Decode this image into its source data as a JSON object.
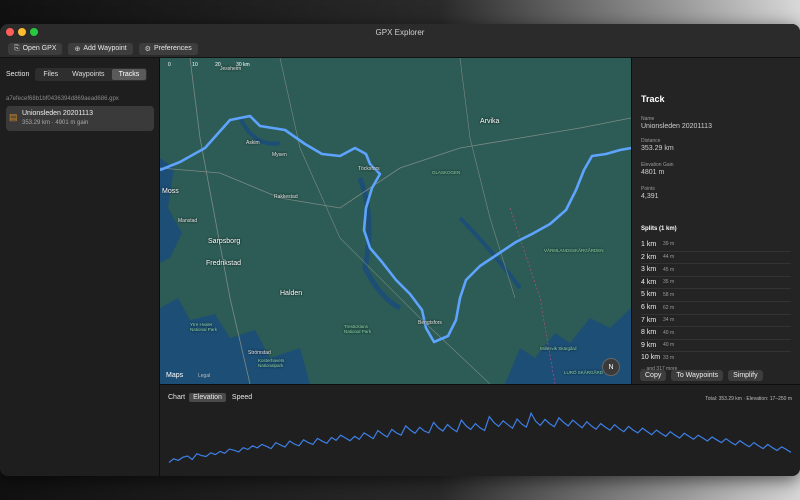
{
  "window": {
    "title": "GPX Explorer"
  },
  "toolbar": {
    "open_label": "Open GPX",
    "add_waypoint_label": "Add Waypoint",
    "preferences_label": "Preferences"
  },
  "sidebar": {
    "section_label": "Section",
    "tabs": [
      "Files",
      "Waypoints",
      "Tracks"
    ],
    "active_tab": "Tracks",
    "file_name": "a7efecef68b1bf0436394d869aead686.gpx",
    "track": {
      "name": "Unionsleden 20201113",
      "subtitle": "353.29 km · 4901 m gain"
    }
  },
  "map": {
    "scale_ticks": [
      "0",
      "10",
      "20",
      "30 km"
    ],
    "labels": [
      {
        "text": "Arvika",
        "cls": "big"
      },
      {
        "text": "Askim",
        "cls": ""
      },
      {
        "text": "Mysen",
        "cls": ""
      },
      {
        "text": "Töcksfors",
        "cls": ""
      },
      {
        "text": "Rakkestad",
        "cls": ""
      },
      {
        "text": "Moss",
        "cls": "big"
      },
      {
        "text": "Sarpsborg",
        "cls": "big"
      },
      {
        "text": "Fredrikstad",
        "cls": "big"
      },
      {
        "text": "Halden",
        "cls": "big"
      },
      {
        "text": "Strömstad",
        "cls": ""
      },
      {
        "text": "Bengtsfors",
        "cls": ""
      },
      {
        "text": "GLASKOGEN",
        "cls": "park"
      },
      {
        "text": "VÄRMLANDSSKÄRGÅRDEN",
        "cls": "park"
      },
      {
        "text": "Tresticklans National Park",
        "cls": "park"
      },
      {
        "text": "Ytre Hvaler National Park",
        "cls": "park"
      },
      {
        "text": "Kosterhavets Nationalpark",
        "cls": "park"
      },
      {
        "text": "Millesvik Skärgård",
        "cls": "park"
      },
      {
        "text": "LURÖ SKÄRGÅRD",
        "cls": "park"
      },
      {
        "text": "Manstad",
        "cls": ""
      },
      {
        "text": "Jessheim",
        "cls": ""
      }
    ],
    "logo": "Maps",
    "legal": "Legal",
    "compass": "N"
  },
  "details": {
    "title": "Track",
    "name_label": "Name",
    "name_value": "Unionsleden 20201113",
    "distance_label": "Distance",
    "distance_value": "353.29 km",
    "elevation_label": "Elevation Gain",
    "elevation_value": "4801 m",
    "points_label": "Points",
    "points_value": "4,391",
    "splits_title": "Splits (1 km)",
    "splits": [
      {
        "km": "1 km",
        "val": "39 m"
      },
      {
        "km": "2 km",
        "val": "44 m"
      },
      {
        "km": "3 km",
        "val": "45 m"
      },
      {
        "km": "4 km",
        "val": "35 m"
      },
      {
        "km": "5 km",
        "val": "58 m"
      },
      {
        "km": "6 km",
        "val": "62 m"
      },
      {
        "km": "7 km",
        "val": "34 m"
      },
      {
        "km": "8 km",
        "val": "40 m"
      },
      {
        "km": "9 km",
        "val": "40 m"
      },
      {
        "km": "10 km",
        "val": "33 m"
      }
    ],
    "more_text": "... and 317 more",
    "actions": [
      "Copy",
      "To Waypoints",
      "Simplify"
    ]
  },
  "chart": {
    "label": "Chart",
    "modes": [
      "Elevation",
      "Speed"
    ],
    "active_mode": "Elevation",
    "summary": "Total: 353.29 km · Elevation: 17–250 m"
  },
  "colors": {
    "route": "#5ea4ff",
    "chart_line": "#3d7fe6",
    "map_land": "#2c5c55",
    "map_water": "#1d4e75"
  },
  "chart_data": {
    "type": "line",
    "title": "",
    "xlabel": "",
    "ylabel": "",
    "ylim": [
      17,
      250
    ],
    "series": [
      {
        "values": [
          32,
          48,
          41,
          55,
          60,
          45,
          70,
          62,
          58,
          74,
          66,
          80,
          72,
          90,
          85,
          78,
          96,
          88,
          104,
          95,
          110,
          102,
          92,
          118,
          108,
          99,
          125,
          112,
          104,
          130,
          118,
          110,
          136,
          124,
          115,
          140,
          128,
          150,
          138,
          126,
          145,
          132,
          160,
          148,
          135,
          170,
          155,
          142,
          175,
          160,
          150,
          190,
          172,
          158,
          184,
          168,
          160,
          205,
          182,
          168,
          196,
          178,
          165,
          215,
          190,
          175,
          200,
          182,
          170,
          230,
          205,
          188,
          212,
          195,
          180,
          220,
          198,
          185,
          245,
          210,
          192,
          218,
          200,
          186,
          225,
          205,
          190,
          215,
          198,
          182,
          208,
          190,
          176,
          200,
          185,
          172,
          195,
          178,
          165,
          188,
          172,
          160,
          180,
          166,
          152,
          172,
          158,
          145,
          165,
          150,
          138,
          158,
          145,
          132,
          150,
          138,
          125,
          142,
          130,
          118,
          135,
          120,
          108,
          126,
          112,
          100,
          118,
          104,
          92,
          110,
          96,
          84,
          100,
          88,
          76
        ]
      }
    ]
  }
}
